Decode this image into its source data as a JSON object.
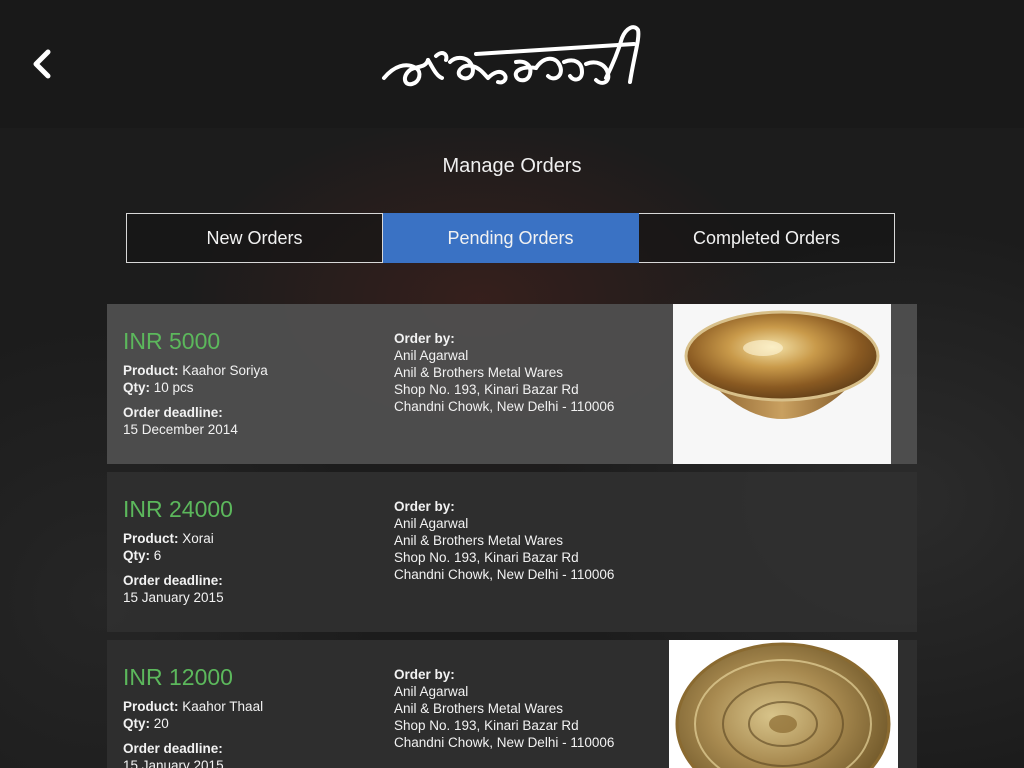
{
  "header": {
    "logo_text": "কাঁহৰ শৰাই",
    "back_icon": "chevron-left-icon"
  },
  "page_title": "Manage Orders",
  "tabs": [
    {
      "label": "New Orders",
      "active": false
    },
    {
      "label": "Pending Orders",
      "active": true
    },
    {
      "label": "Completed Orders",
      "active": false
    }
  ],
  "labels": {
    "product": "Product:",
    "qty": "Qty:",
    "deadline": "Order deadline:",
    "order_by": "Order by:"
  },
  "orders": [
    {
      "price": "INR 5000",
      "product": "Kaahor Soriya",
      "qty": "10 pcs",
      "deadline": "15 December 2014",
      "buyer_name": "Anil Agarwal",
      "buyer_company": "Anil & Brothers Metal Wares",
      "buyer_address1": "Shop No. 193, Kinari Bazar Rd",
      "buyer_address2": "Chandni Chowk, New Delhi - 110006",
      "image": "brass-bowl"
    },
    {
      "price": "INR 24000",
      "product": "Xorai",
      "qty": "6",
      "deadline": "15 January 2015",
      "buyer_name": "Anil Agarwal",
      "buyer_company": "Anil & Brothers Metal Wares",
      "buyer_address1": "Shop No. 193, Kinari Bazar Rd",
      "buyer_address2": "Chandni Chowk, New Delhi - 110006"
    },
    {
      "price": "INR 12000",
      "product": "Kaahor Thaal",
      "qty": "20",
      "deadline": "15 January 2015",
      "buyer_name": "Anil Agarwal",
      "buyer_company": "Anil & Brothers Metal Wares",
      "buyer_address1": "Shop No. 193, Kinari Bazar Rd",
      "buyer_address2": "Chandni Chowk, New Delhi - 110006",
      "image": "brass-plate"
    }
  ],
  "colors": {
    "accent_tab": "#3a72c4",
    "price_green": "#5cb85c"
  }
}
